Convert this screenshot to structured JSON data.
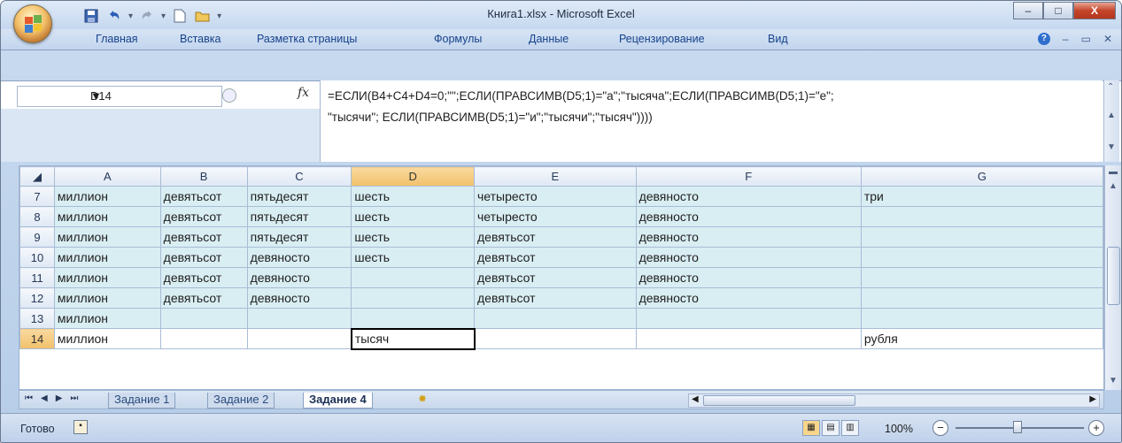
{
  "window": {
    "title": "Книга1.xlsx - Microsoft Excel",
    "minimize_label": "–",
    "maximize_label": "□",
    "close_label": "X"
  },
  "ribbon": {
    "tabs": [
      "Главная",
      "Вставка",
      "Разметка страницы",
      "Формулы",
      "Данные",
      "Рецензирование",
      "Вид"
    ]
  },
  "formula_bar": {
    "name_box": "D14",
    "fx_label": "fx",
    "formula": "=ЕСЛИ(B4+C4+D4=0;\"\";ЕСЛИ(ПРАВСИМВ(D5;1)=\"а\";\"тысяча\";ЕСЛИ(ПРАВСИМВ(D5;1)=\"е\";\n\"тысячи\"; ЕСЛИ(ПРАВСИМВ(D5;1)=\"и\";\"тысячи\";\"тысяч\"))))"
  },
  "grid": {
    "columns": [
      "A",
      "B",
      "C",
      "D",
      "E",
      "F",
      "G"
    ],
    "selected_column": "D",
    "selected_row": "14",
    "rows": [
      {
        "num": "7",
        "cells": [
          "миллион",
          "девятьсот",
          "пятьдесят",
          "шесть",
          "четыресто",
          "девяносто",
          "три"
        ]
      },
      {
        "num": "8",
        "cells": [
          "миллион",
          "девятьсот",
          "пятьдесят",
          "шесть",
          "четыресто",
          "девяносто",
          ""
        ]
      },
      {
        "num": "9",
        "cells": [
          "миллион",
          "девятьсот",
          "пятьдесят",
          "шесть",
          "девятьсот",
          "девяносто",
          ""
        ]
      },
      {
        "num": "10",
        "cells": [
          "миллион",
          "девятьсот",
          "девяносто",
          "шесть",
          "девятьсот",
          "девяносто",
          ""
        ]
      },
      {
        "num": "11",
        "cells": [
          "миллион",
          "девятьсот",
          "девяносто",
          "",
          "девятьсот",
          "девяносто",
          ""
        ]
      },
      {
        "num": "12",
        "cells": [
          "миллион",
          "девятьсот",
          "девяносто",
          "",
          "девятьсот",
          "девяносто",
          ""
        ]
      },
      {
        "num": "13",
        "cells": [
          "миллион",
          "",
          "",
          "",
          "",
          "",
          ""
        ]
      },
      {
        "num": "14",
        "cells": [
          "миллион",
          "",
          "",
          "тысяч",
          "",
          "",
          "рубля"
        ]
      }
    ]
  },
  "sheet_tabs": {
    "tabs": [
      "Задание 1",
      "Задание 2",
      "Задание 4"
    ],
    "active": "Задание 4"
  },
  "status_bar": {
    "status": "Готово",
    "zoom": "100%",
    "zoom_minus": "−",
    "zoom_plus": "+"
  },
  "icons": {
    "save": "save-icon",
    "undo": "undo-icon",
    "redo": "redo-icon",
    "new": "new-file-icon",
    "open": "open-folder-icon"
  },
  "colors": {
    "row_highlight": "#d9eef3",
    "selected_header": "#f1c16b",
    "close_button": "#c5452a"
  }
}
